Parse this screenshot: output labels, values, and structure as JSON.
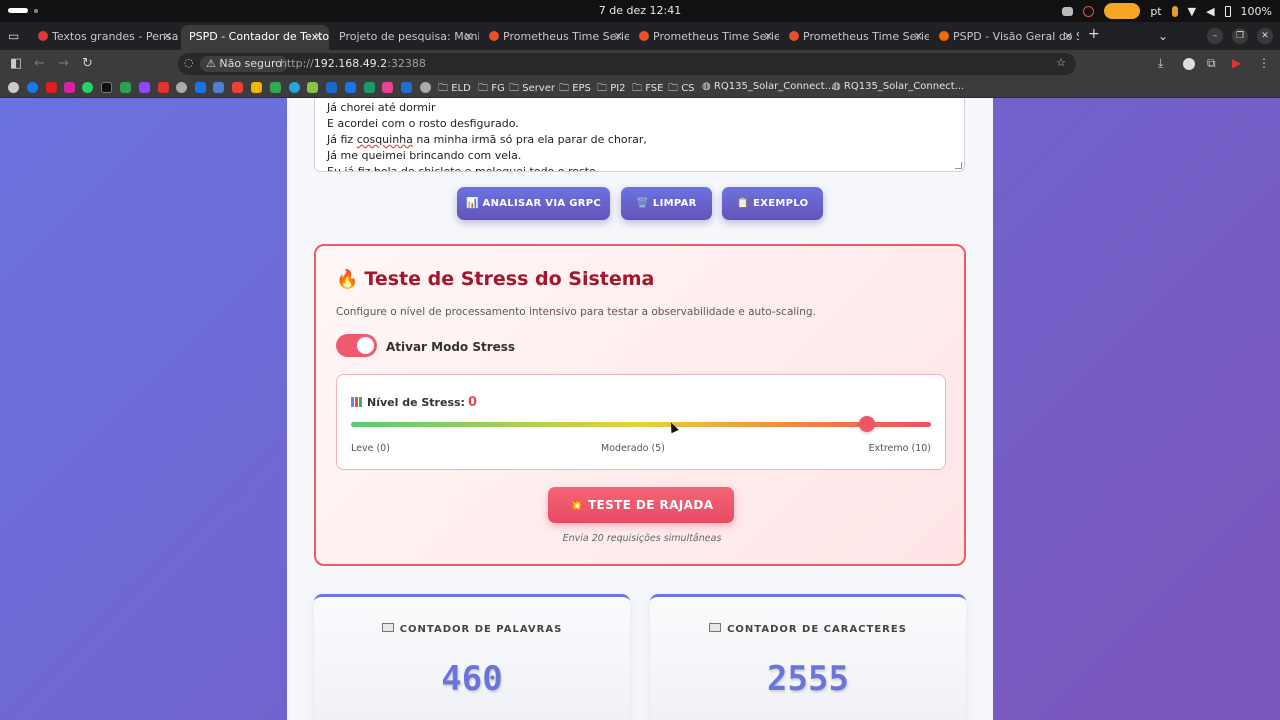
{
  "os": {
    "clock": "7 de dez  12:41",
    "lang": "pt",
    "battery": "100%"
  },
  "tabs": [
    {
      "title": "Textos grandes - Pensado",
      "active": false,
      "favicon_color": "#d93a3a"
    },
    {
      "title": "PSPD - Contador de Texto vi",
      "active": true,
      "favicon_color": ""
    },
    {
      "title": "Projeto de pesquisa: Monitor",
      "active": false,
      "favicon_color": ""
    },
    {
      "title": "Prometheus Time Series",
      "active": false,
      "favicon_color": "#e6522c"
    },
    {
      "title": "Prometheus Time Series",
      "active": false,
      "favicon_color": "#e6522c"
    },
    {
      "title": "Prometheus Time Series",
      "active": false,
      "favicon_color": "#e6522c"
    },
    {
      "title": "PSPD - Visão Geral do Sis",
      "active": false,
      "favicon_color": "#f46800"
    }
  ],
  "address": {
    "security": "Não seguro",
    "url_prefix": "http://",
    "url_host": "192.168.49.2",
    "url_port": ":32388"
  },
  "bookmarks": [
    "ELD",
    "FG",
    "Server",
    "EPS",
    "PI2",
    "FSE",
    "CS",
    "RQ135_Solar_Connect...",
    "RQ135_Solar_Connect..."
  ],
  "textarea": {
    "lines": [
      "Já chorei até dormir",
      "E acordei com o rosto desfigurado.",
      "Já fiz ",
      "cosquinha",
      " na minha irmã só pra ela parar de chorar,",
      "Já me queimei brincando com vela.",
      "Eu já fiz bola de chiclete e melequei todo o rosto"
    ]
  },
  "buttons": {
    "analyze": "📊 ANALISAR VIA GRPC",
    "clear": "🗑️ LIMPAR",
    "example": "📋 EXEMPLO"
  },
  "stress": {
    "icon": "🔥",
    "title": "Teste de Stress do Sistema",
    "description": "Configure o nível de processamento intensivo para testar a observabilidade e auto-scaling.",
    "toggle_label": "Ativar Modo Stress",
    "toggle_on": true,
    "level_label": "Nível de Stress:",
    "level_value": "0",
    "slider_fraction": 0.89,
    "tick_low": "Leve (0)",
    "tick_mid": "Moderado (5)",
    "tick_high": "Extremo (10)",
    "burst_button": "TESTE DE RAJADA",
    "burst_icon": "💥",
    "burst_note": "Envia 20 requisições simultâneas"
  },
  "counters": [
    {
      "label": "CONTADOR DE PALAVRAS",
      "value": "460"
    },
    {
      "label": "CONTADOR DE CARACTERES",
      "value": "2555"
    }
  ],
  "colors": {
    "accent": "#6b74e0",
    "danger": "#ef5b6a",
    "page_bg_start": "#6a72df",
    "page_bg_end": "#7a55bb"
  }
}
